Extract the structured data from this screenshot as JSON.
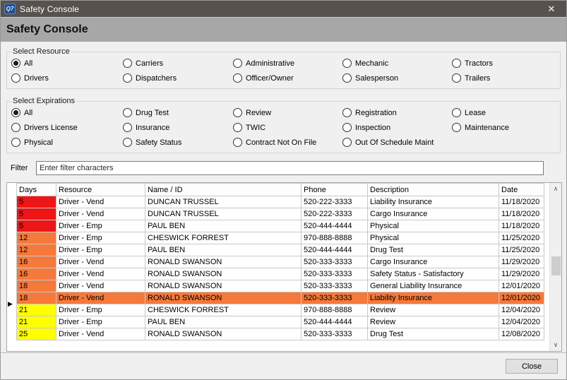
{
  "window": {
    "title": "Safety Console",
    "app_icon_text": "Q7",
    "close_icon": "✕"
  },
  "header": {
    "title": "Safety Console"
  },
  "resource_group": {
    "legend": "Select Resource",
    "selected": "All",
    "columns": [
      [
        "All",
        "Drivers"
      ],
      [
        "Carriers",
        "Dispatchers"
      ],
      [
        "Administrative",
        "Officer/Owner"
      ],
      [
        "Mechanic",
        "Salesperson"
      ],
      [
        "Tractors",
        "Trailers"
      ]
    ]
  },
  "expirations_group": {
    "legend": "Select Expirations",
    "selected": "All",
    "columns": [
      [
        "All",
        "Drivers License",
        "Physical"
      ],
      [
        "Drug Test",
        "Insurance",
        "Safety Status"
      ],
      [
        "Review",
        "TWIC",
        "Contract Not On File"
      ],
      [
        "Registration",
        "Inspection",
        "Out Of Schedule Maint"
      ],
      [
        "Lease",
        "Maintenance"
      ]
    ]
  },
  "filter": {
    "label": "Filter",
    "placeholder": "Enter filter characters"
  },
  "grid": {
    "columns": [
      "Days",
      "Resource",
      "Name / ID",
      "Phone",
      "Description",
      "Date"
    ],
    "severity_colors": {
      "red": "#ed1515",
      "orange": "#f5793b",
      "yellow": "#ffff00"
    },
    "selected_row_color": "#f5793b",
    "rows": [
      {
        "days": "5",
        "severity": "red",
        "resource": "Driver - Vend",
        "name": "DUNCAN TRUSSEL",
        "phone": "520-222-3333",
        "description": "Liability Insurance",
        "date": "11/18/2020",
        "selected": false
      },
      {
        "days": "5",
        "severity": "red",
        "resource": "Driver - Vend",
        "name": "DUNCAN TRUSSEL",
        "phone": "520-222-3333",
        "description": "Cargo Insurance",
        "date": "11/18/2020",
        "selected": false
      },
      {
        "days": "5",
        "severity": "red",
        "resource": "Driver - Emp",
        "name": "PAUL BEN",
        "phone": "520-444-4444",
        "description": "Physical",
        "date": "11/18/2020",
        "selected": false
      },
      {
        "days": "12",
        "severity": "orange",
        "resource": "Driver - Emp",
        "name": "CHESWICK FORREST",
        "phone": "970-888-8888",
        "description": "Physical",
        "date": "11/25/2020",
        "selected": false
      },
      {
        "days": "12",
        "severity": "orange",
        "resource": "Driver - Emp",
        "name": "PAUL BEN",
        "phone": "520-444-4444",
        "description": "Drug Test",
        "date": "11/25/2020",
        "selected": false
      },
      {
        "days": "16",
        "severity": "orange",
        "resource": "Driver - Vend",
        "name": "RONALD SWANSON",
        "phone": "520-333-3333",
        "description": "Cargo Insurance",
        "date": "11/29/2020",
        "selected": false
      },
      {
        "days": "16",
        "severity": "orange",
        "resource": "Driver - Vend",
        "name": "RONALD SWANSON",
        "phone": "520-333-3333",
        "description": "Safety Status - Satisfactory",
        "date": "11/29/2020",
        "selected": false
      },
      {
        "days": "18",
        "severity": "orange",
        "resource": "Driver - Vend",
        "name": "RONALD SWANSON",
        "phone": "520-333-3333",
        "description": "General Liability Insurance",
        "date": "12/01/2020",
        "selected": false
      },
      {
        "days": "18",
        "severity": "orange",
        "resource": "Driver - Vend",
        "name": "RONALD SWANSON",
        "phone": "520-333-3333",
        "description": "Liability Insurance",
        "date": "12/01/2020",
        "selected": true
      },
      {
        "days": "21",
        "severity": "yellow",
        "resource": "Driver - Emp",
        "name": "CHESWICK FORREST",
        "phone": "970-888-8888",
        "description": "Review",
        "date": "12/04/2020",
        "selected": false
      },
      {
        "days": "21",
        "severity": "yellow",
        "resource": "Driver - Emp",
        "name": "PAUL BEN",
        "phone": "520-444-4444",
        "description": "Review",
        "date": "12/04/2020",
        "selected": false
      },
      {
        "days": "25",
        "severity": "yellow",
        "resource": "Driver - Vend",
        "name": "RONALD SWANSON",
        "phone": "520-333-3333",
        "description": "Drug Test",
        "date": "12/08/2020",
        "selected": false
      }
    ],
    "marker_icon": "▶"
  },
  "scrollbar": {
    "up_icon": "∧",
    "down_icon": "∨"
  },
  "footer": {
    "close_label": "Close"
  }
}
